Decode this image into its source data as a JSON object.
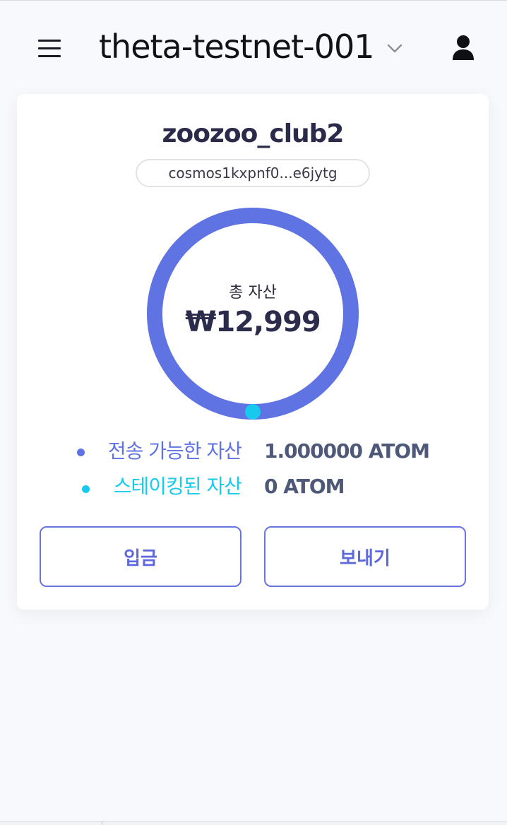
{
  "header": {
    "chain_name": "theta-testnet-001"
  },
  "account": {
    "name": "zoozoo_club2",
    "address_short": "cosmos1kxpnf0...e6jytg"
  },
  "balance": {
    "total_label": "총 자산",
    "total_value": "₩12,999",
    "available_fraction": 1.0,
    "staked_fraction": 0.0
  },
  "legend": [
    {
      "label": "전송 가능한 자산",
      "value": "1.000000 ATOM",
      "color": "#5f73e3"
    },
    {
      "label": "스테이킹된 자산",
      "value": "0 ATOM",
      "color": "#18c9ee"
    }
  ],
  "actions": {
    "deposit_label": "입금",
    "send_label": "보내기"
  },
  "colors": {
    "accent": "#5f73e3",
    "staked": "#18c9ee",
    "button_border": "#6a74e0"
  }
}
